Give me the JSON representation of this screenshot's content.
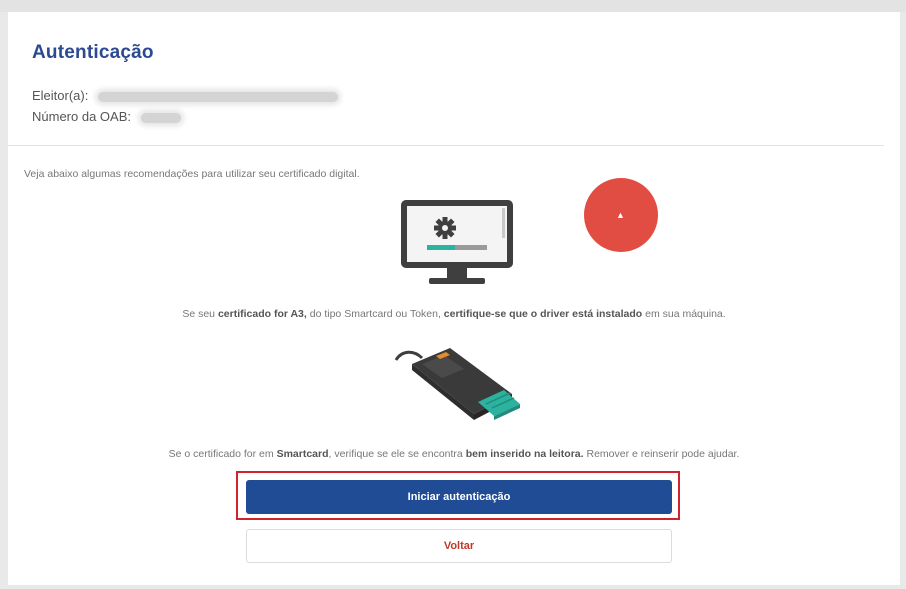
{
  "page": {
    "title": "Autenticação",
    "elector_label": "Eleitor(a):",
    "oab_label": "Número da OAB:",
    "intro": "Veja abaixo algumas recomendações para utilizar seu certificado digital.",
    "tip_a3": {
      "p1": "Se seu ",
      "b1": "certificado for A3,",
      "p2": " do tipo Smartcard ou Token, ",
      "b2": "certifique-se que o driver está instalado",
      "p3": " em sua máquina."
    },
    "tip_smartcard": {
      "p1": "Se o certificado for em ",
      "b1": "Smartcard",
      "p2": ", verifique se ele se encontra ",
      "b2": "bem inserido na leitora.",
      "p3": " Remover e reinserir pode ajudar."
    },
    "start_button": "Iniciar autenticação",
    "back_button": "Voltar"
  },
  "icons": {
    "monitor": "computer-settings-icon",
    "reader": "smartcard-reader-icon",
    "cursor": "mouse-click-indicator"
  },
  "colors": {
    "title": "#2b4a8f",
    "primary_button": "#1f4c94",
    "back_text": "#c0392b",
    "highlight": "#d2232a",
    "click_circle": "#e24d43"
  }
}
